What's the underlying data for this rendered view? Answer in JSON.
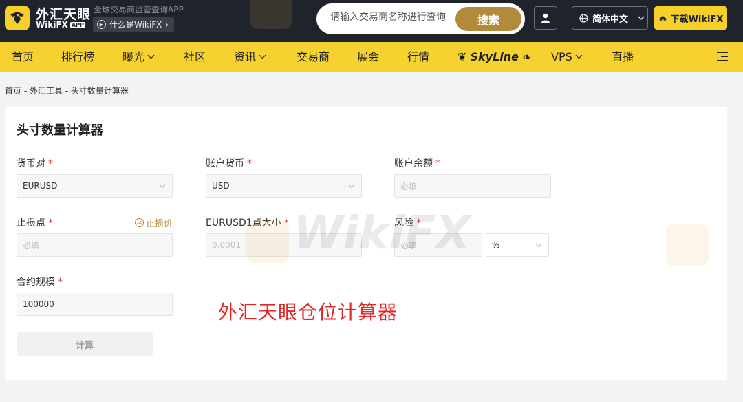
{
  "header": {
    "brand_cn": "外汇天眼",
    "brand_en": "WikiFX",
    "brand_app_badge": "APP",
    "tagline": "全球交易商监管查询APP",
    "what_is_label": "什么是WikiFX",
    "what_is_chevron": "›",
    "search_placeholder": "请输入交易商名称进行查询",
    "search_button": "搜索",
    "language": "简体中文",
    "download_label": "下载WikiFX"
  },
  "nav": {
    "items": [
      {
        "label": "首页"
      },
      {
        "label": "排行榜"
      },
      {
        "label": "曝光"
      },
      {
        "label": "社区"
      },
      {
        "label": "资讯"
      },
      {
        "label": "交易商"
      },
      {
        "label": "展会"
      },
      {
        "label": "行情"
      },
      {
        "label": "SkyLine"
      },
      {
        "label": "VPS"
      },
      {
        "label": "直播"
      }
    ]
  },
  "breadcrumb": "首页 - 外汇工具 - 头寸数量计算器",
  "calculator": {
    "title": "头寸数量计算器",
    "required_mark": "*",
    "currency_pair": {
      "label": "货币对",
      "value": "EURUSD"
    },
    "account_currency": {
      "label": "账户货币",
      "value": "USD"
    },
    "account_balance": {
      "label": "账户余额",
      "placeholder": "必填"
    },
    "stop_loss": {
      "label": "止损点",
      "placeholder": "必填",
      "link": "止损价",
      "link_icon": "⇄"
    },
    "pip_size": {
      "label": "EURUSD1点大小",
      "value": "0.0001"
    },
    "risk": {
      "label": "风险",
      "placeholder": "必填",
      "unit": "%"
    },
    "contract_size": {
      "label": "合约规模",
      "value": "100000"
    },
    "calc_button": "计算"
  },
  "annotation": "外汇天眼仓位计算器",
  "watermark": "WikiFX",
  "colors": {
    "brand_yellow": "#f6d230",
    "gold": "#b28a3c",
    "dark": "#1f232b",
    "required_red": "#e23b3b",
    "annotation_red": "#e52626"
  }
}
